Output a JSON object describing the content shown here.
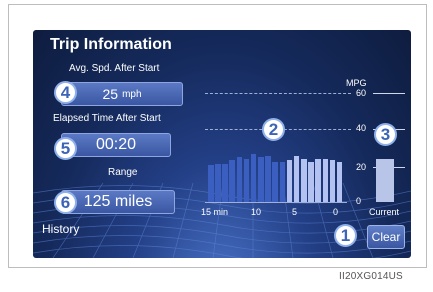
{
  "screen": {
    "title": "Trip Information",
    "avg_speed": {
      "label": "Avg. Spd. After Start",
      "value": "25",
      "unit": "mph",
      "callout": "4"
    },
    "elapsed": {
      "label": "Elapsed Time After Start",
      "value": "00:20",
      "callout": "5"
    },
    "range": {
      "label": "Range",
      "value": "125 miles",
      "callout": "6"
    },
    "history_label": "History",
    "clear_label": "Clear",
    "graph_callout": "2",
    "current_callout": "3",
    "clear_callout": "1"
  },
  "caption": "II20XG014US",
  "colors": {
    "screen_bg": "#152a5c",
    "past_bar": "#3b5fc0",
    "recent_bar": "#b3c2f0",
    "current_bar": "#b8c4e8"
  },
  "chart_data": {
    "type": "bar",
    "ylabel": "MPG",
    "y_ticks": [
      "60",
      "40",
      "20",
      "0"
    ],
    "ylim": [
      0,
      60
    ],
    "x_ticks": [
      "15 min",
      "10",
      "5",
      "0"
    ],
    "bars": [
      23,
      24,
      24,
      26,
      28,
      27,
      30,
      28,
      29,
      25,
      25,
      26,
      29,
      27,
      25,
      27,
      27,
      26,
      25
    ],
    "recent_bar_count": 8,
    "current": {
      "label": "Current",
      "value": 27
    }
  }
}
